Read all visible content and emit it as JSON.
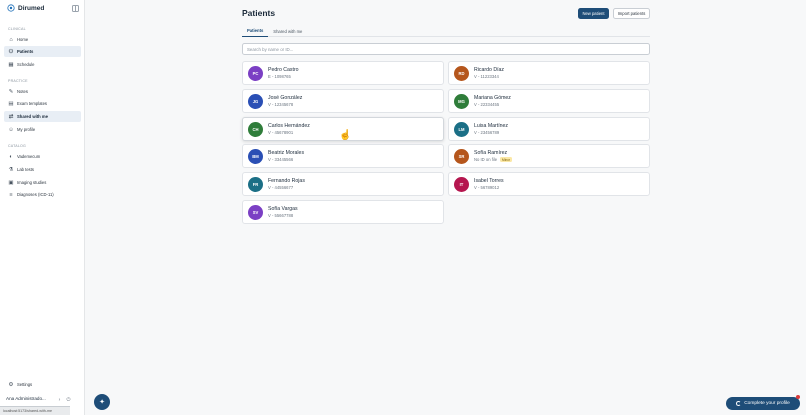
{
  "app": {
    "name": "Dirumed"
  },
  "sidebar": {
    "sections": [
      {
        "label": "CLINICAL",
        "items": [
          {
            "label": "Home",
            "icon": "home-icon",
            "active": false
          },
          {
            "label": "Patients",
            "icon": "people-icon",
            "active": true
          },
          {
            "label": "Schedule",
            "icon": "calendar-icon",
            "active": false
          }
        ]
      },
      {
        "label": "PRACTICE",
        "items": [
          {
            "label": "Notes",
            "icon": "note-icon",
            "active": false
          },
          {
            "label": "Exam templates",
            "icon": "document-icon",
            "active": false
          },
          {
            "label": "Shared with me",
            "icon": "shared-icon",
            "active": true
          },
          {
            "label": "My profile",
            "icon": "user-icon",
            "active": false
          }
        ]
      },
      {
        "label": "CATALOG",
        "items": [
          {
            "label": "Vademecum",
            "icon": "pill-icon",
            "active": false
          },
          {
            "label": "Lab tests",
            "icon": "flask-icon",
            "active": false
          },
          {
            "label": "Imaging studies",
            "icon": "image-icon",
            "active": false
          },
          {
            "label": "Diagnoses (ICD-11)",
            "icon": "list-icon",
            "active": false
          }
        ]
      }
    ],
    "settings_label": "Settings",
    "user_name": "Ana Administrado...",
    "status_text": "localhost:5173/shared-with-me"
  },
  "header": {
    "title": "Patients",
    "new_patient_label": "New patient",
    "import_label": "Import patients"
  },
  "tabs": [
    {
      "label": "Patients",
      "active": true
    },
    {
      "label": "Shared with me",
      "active": false
    }
  ],
  "search": {
    "placeholder": "Search by name or ID..."
  },
  "patients": [
    {
      "initials": "PC",
      "name": "Pedro Castro",
      "id": "E - 1098765",
      "color": "#7b3fc4",
      "badge": ""
    },
    {
      "initials": "RD",
      "name": "Ricardo Díaz",
      "id": "V - 11223344",
      "color": "#b5561c",
      "badge": ""
    },
    {
      "initials": "JG",
      "name": "José González",
      "id": "V - 12345678",
      "color": "#2a4fb5",
      "badge": ""
    },
    {
      "initials": "MG",
      "name": "Mariana Gómez",
      "id": "V - 22334455",
      "color": "#2f7d3a",
      "badge": ""
    },
    {
      "initials": "CH",
      "name": "Carlos Hernández",
      "id": "V - 45678901",
      "color": "#2f7d3a",
      "badge": ""
    },
    {
      "initials": "LM",
      "name": "Luisa Martínez",
      "id": "V - 23456789",
      "color": "#1b6f86",
      "badge": ""
    },
    {
      "initials": "BM",
      "name": "Beatriz Morales",
      "id": "V - 33445566",
      "color": "#2a4fb5",
      "badge": ""
    },
    {
      "initials": "SR",
      "name": "Sofía Ramírez",
      "id": "No ID on file",
      "color": "#b5561c",
      "badge": "Minor"
    },
    {
      "initials": "FR",
      "name": "Fernando Rojas",
      "id": "V - 44556677",
      "color": "#1b6f86",
      "badge": ""
    },
    {
      "initials": "IT",
      "name": "Isabel Torres",
      "id": "V - 56789012",
      "color": "#b5164f",
      "badge": ""
    },
    {
      "initials": "SV",
      "name": "Sofía Vargas",
      "id": "V - 55667788",
      "color": "#7b3fc4",
      "badge": ""
    }
  ],
  "footer": {
    "complete_profile_label": "Complete your profile"
  },
  "colors": {
    "primary": "#1e4d78"
  }
}
